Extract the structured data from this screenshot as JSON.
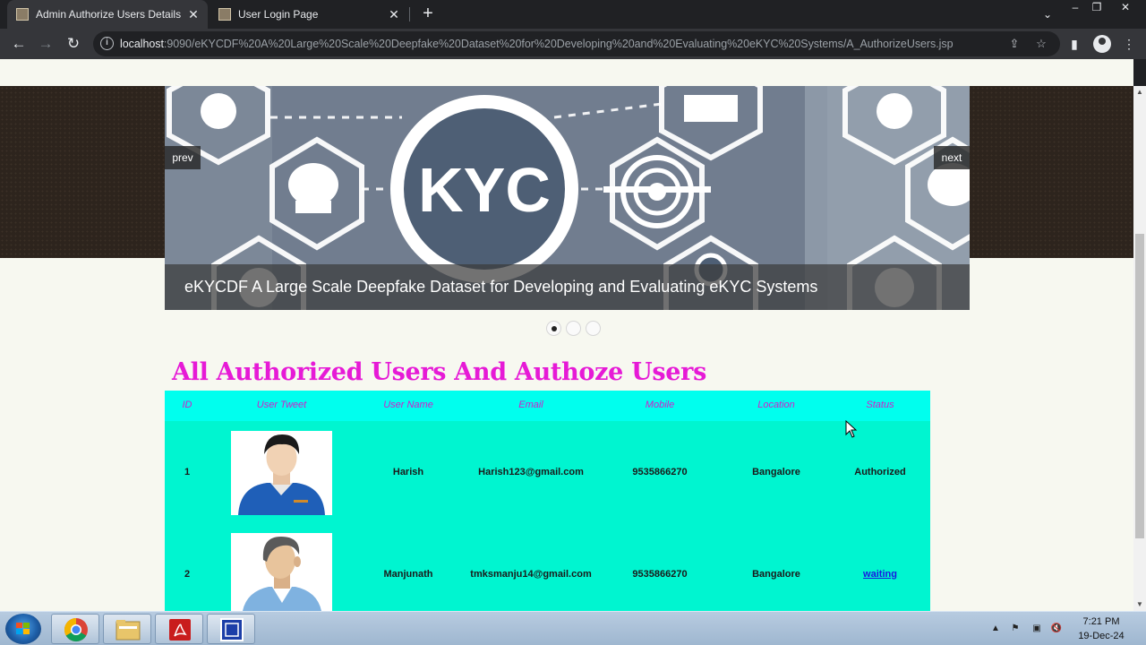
{
  "browser": {
    "tabs": [
      {
        "title": "Admin Authorize Users Details",
        "active": true
      },
      {
        "title": "User Login Page",
        "active": false
      }
    ],
    "new_tab_icon": "plus-icon",
    "url_host": "localhost",
    "url_rest": ":9090/eKYCDF%20A%20Large%20Scale%20Deepfake%20Dataset%20for%20Developing%20and%20Evaluating%20eKYC%20Systems/A_AuthorizeUsers.jsp"
  },
  "slider": {
    "prev_label": "prev",
    "next_label": "next",
    "caption": "eKYCDF A Large Scale Deepfake Dataset for Developing and Evaluating eKYC Systems",
    "image_text": "KYC",
    "dots_count": 3,
    "active_dot": 1
  },
  "page": {
    "heading": "All Authorized Users And Authoze Users"
  },
  "table": {
    "headers": [
      "ID",
      "User Tweet",
      "User Name",
      "Email",
      "Mobile",
      "Location",
      "Status"
    ],
    "rows": [
      {
        "id": "1",
        "name": "Harish",
        "email": "Harish123@gmail.com",
        "mobile": "9535866270",
        "location": "Bangalore",
        "status": "Authorized",
        "status_is_link": false,
        "avatar": "male-avatar-blue-shirt"
      },
      {
        "id": "2",
        "name": "Manjunath",
        "email": "tmksmanju14@gmail.com",
        "mobile": "9535866270",
        "location": "Bangalore",
        "status": "waiting",
        "status_is_link": true,
        "avatar": "male-avatar-gray-hair"
      }
    ]
  },
  "taskbar": {
    "apps": [
      "chrome-icon",
      "file-explorer-icon",
      "pdf-reader-icon",
      "app-window-icon"
    ],
    "time": "7:21 PM",
    "date": "19-Dec-24"
  },
  "colors": {
    "heading": "#e61ad6",
    "table_header_bg": "#00ffee",
    "table_body_bg": "#00f5d0",
    "header_text": "#d11fc9",
    "link": "#1a1ae0"
  }
}
